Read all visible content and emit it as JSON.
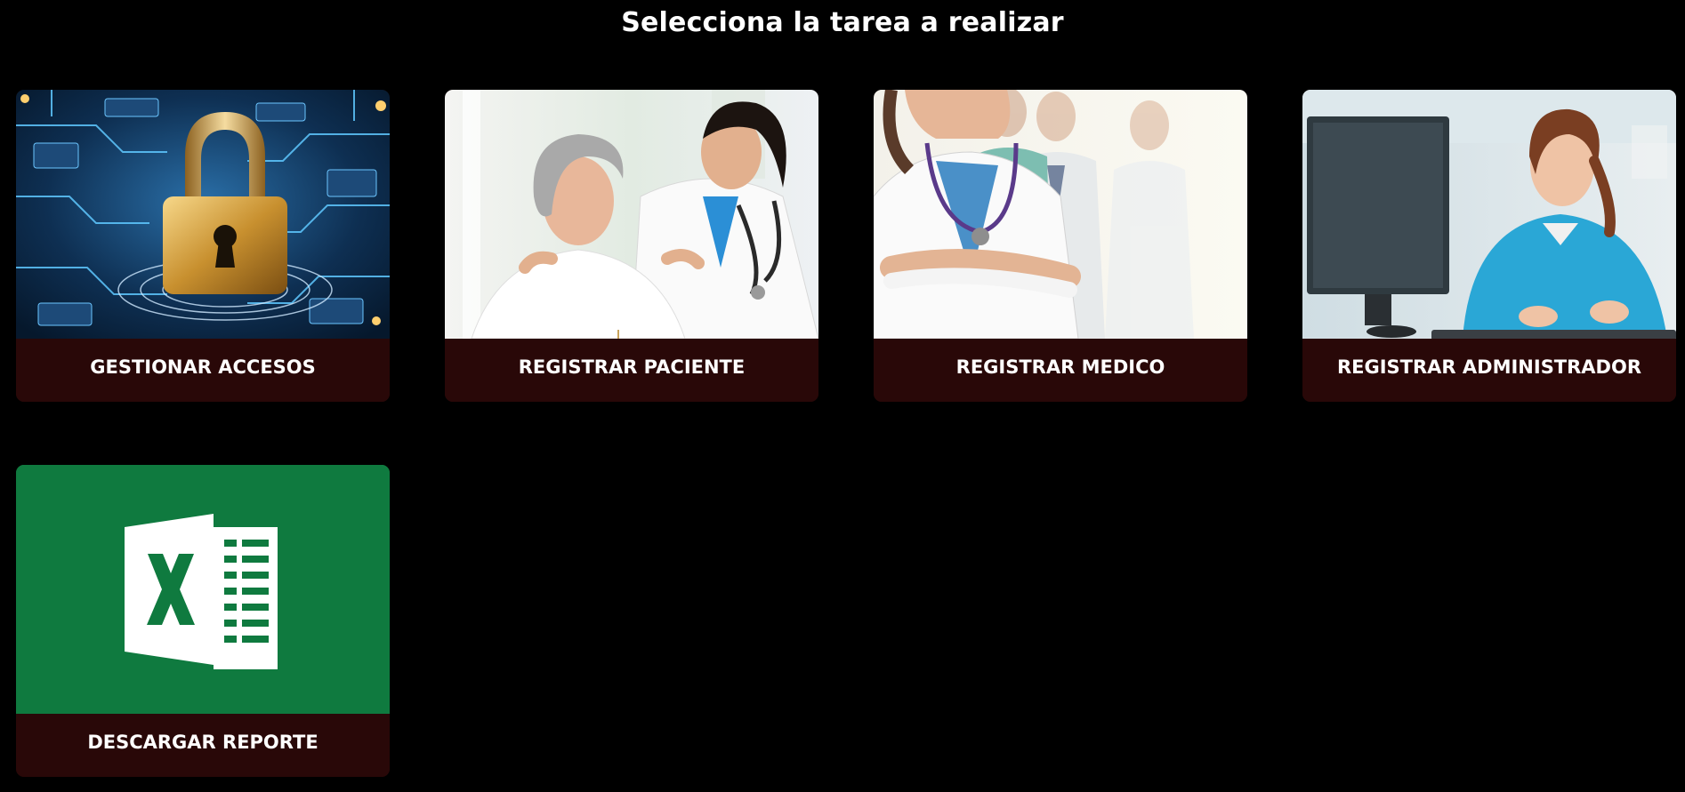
{
  "header": {
    "title": "Selecciona la tarea a realizar"
  },
  "cards": [
    {
      "label": "GESTIONAR ACCESOS",
      "image": "padlock-on-circuit-board"
    },
    {
      "label": "REGISTRAR PACIENTE",
      "image": "nurse-with-patient"
    },
    {
      "label": "REGISTRAR MEDICO",
      "image": "doctors-team"
    },
    {
      "label": "REGISTRAR ADMINISTRADOR",
      "image": "administrator-at-computer"
    },
    {
      "label": "DESCARGAR REPORTE",
      "image": "excel-icon"
    }
  ],
  "colors": {
    "background": "#000000",
    "card_label_bg": "#290808",
    "excel_green": "#107C41",
    "title_text": "#ffffff"
  }
}
